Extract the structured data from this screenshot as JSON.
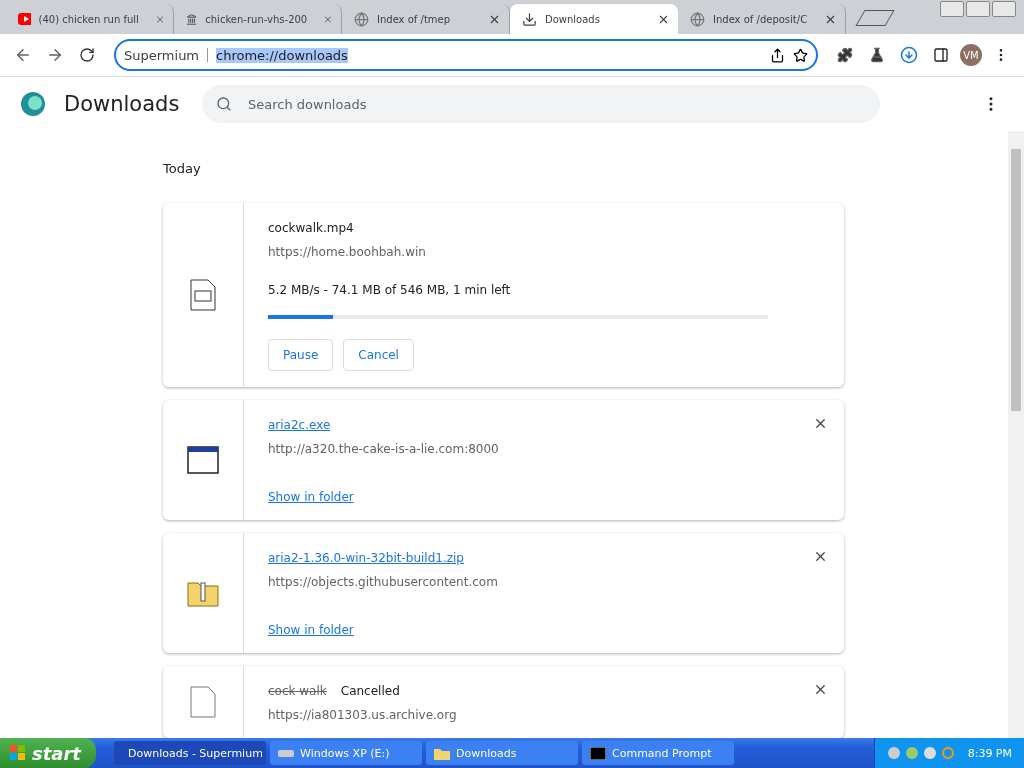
{
  "tabs": [
    {
      "title": "(40) chicken run full",
      "selected": false
    },
    {
      "title": "chicken-run-vhs-200",
      "selected": false
    },
    {
      "title": "Index of /tmep",
      "selected": false
    },
    {
      "title": "Downloads",
      "selected": true
    },
    {
      "title": "Index of /deposit/C",
      "selected": false
    }
  ],
  "address_bar": {
    "site": "Supermium",
    "url": "chrome://downloads"
  },
  "profile": {
    "initials": "VM"
  },
  "page": {
    "title": "Downloads",
    "search": {
      "placeholder": "Search downloads"
    },
    "section": "Today",
    "items": [
      {
        "kind": "active",
        "name": "cockwalk.mp4",
        "source": "https://home.boohbah.win",
        "status": "5.2 MB/s - 74.1 MB of 546 MB, 1 min left",
        "level": 0.13,
        "actions": [
          "Pause",
          "Cancel"
        ]
      },
      {
        "kind": "complete",
        "name": "aria2c.exe",
        "source": "http://a320.the-cake-is-a-lie.com:8000",
        "link": "Show in folder"
      },
      {
        "kind": "complete",
        "name": "aria2-1.36.0-win-32bit-build1.zip",
        "source": "https://objects.githubusercontent.com",
        "link": "Show in folder"
      },
      {
        "kind": "cancelled",
        "name": "cock walk",
        "status": "Cancelled",
        "source": "https://ia801303.us.archive.org"
      }
    ]
  },
  "taskbar": {
    "start": "start",
    "windows": [
      {
        "title": "Downloads - Supermium",
        "selected": true
      },
      {
        "title": "Windows XP (E:)",
        "selected": false
      },
      {
        "title": "Downloads",
        "selected": false
      },
      {
        "title": "Command Prompt",
        "selected": false
      }
    ],
    "clock": "8:39 PM"
  }
}
